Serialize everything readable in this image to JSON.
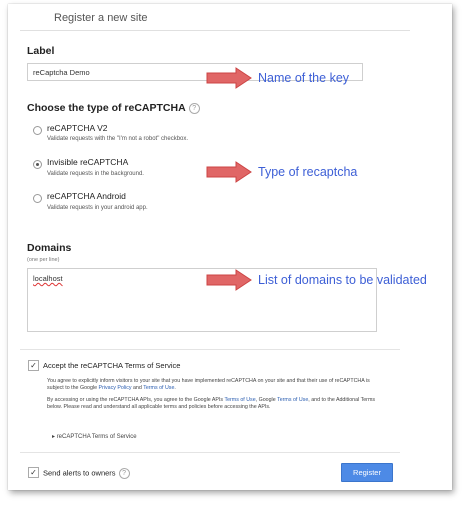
{
  "page": {
    "title": "Register a new site"
  },
  "label_section": {
    "title": "Label",
    "input_value": "reCaptcha Demo"
  },
  "type_section": {
    "title": "Choose the type of reCAPTCHA",
    "help_icon": "?",
    "options": [
      {
        "title": "reCAPTCHA V2",
        "desc": "Validate requests with the \"I'm not a robot\" checkbox.",
        "selected": false
      },
      {
        "title": "Invisible reCAPTCHA",
        "desc": "Validate requests in the background.",
        "selected": true
      },
      {
        "title": "reCAPTCHA Android",
        "desc": "Validate requests in your android app.",
        "selected": false
      }
    ]
  },
  "domains_section": {
    "title": "Domains",
    "hint": "(one per line)",
    "value": "localhost"
  },
  "tos": {
    "checkbox_label": "Accept the reCAPTCHA Terms of Service",
    "checked": true,
    "para1": "You agree to explicitly inform visitors to your site that you have implemented reCAPTCHA on your site and that their use of reCAPTCHA is subject to the Google ",
    "para1_link1": "Privacy Policy",
    "para1_mid": " and ",
    "para1_link2": "Terms of Use",
    "para1_end": ".",
    "para2": "By accessing or using the reCAPTCHA APIs, you agree to the Google APIs ",
    "para2_link1": "Terms of Use",
    "para2_mid": ", Google ",
    "para2_link2": "Terms of Use",
    "para2_end": ", and to the Additional Terms below. Please read and understand all applicable terms and policies before accessing the APIs.",
    "expander": "reCAPTCHA Terms of Service"
  },
  "alerts": {
    "checkbox_label": "Send alerts to owners",
    "checked": true,
    "help_icon": "?"
  },
  "register_button": "Register",
  "annotations": {
    "label_note": "Name of the key",
    "type_note": "Type of recaptcha",
    "domains_note": "List of domains to be validated"
  },
  "colors": {
    "arrow_fill": "#e06666",
    "arrow_stroke": "#cc4444",
    "note_text": "#3d5fd6",
    "button": "#4d8ae6"
  }
}
